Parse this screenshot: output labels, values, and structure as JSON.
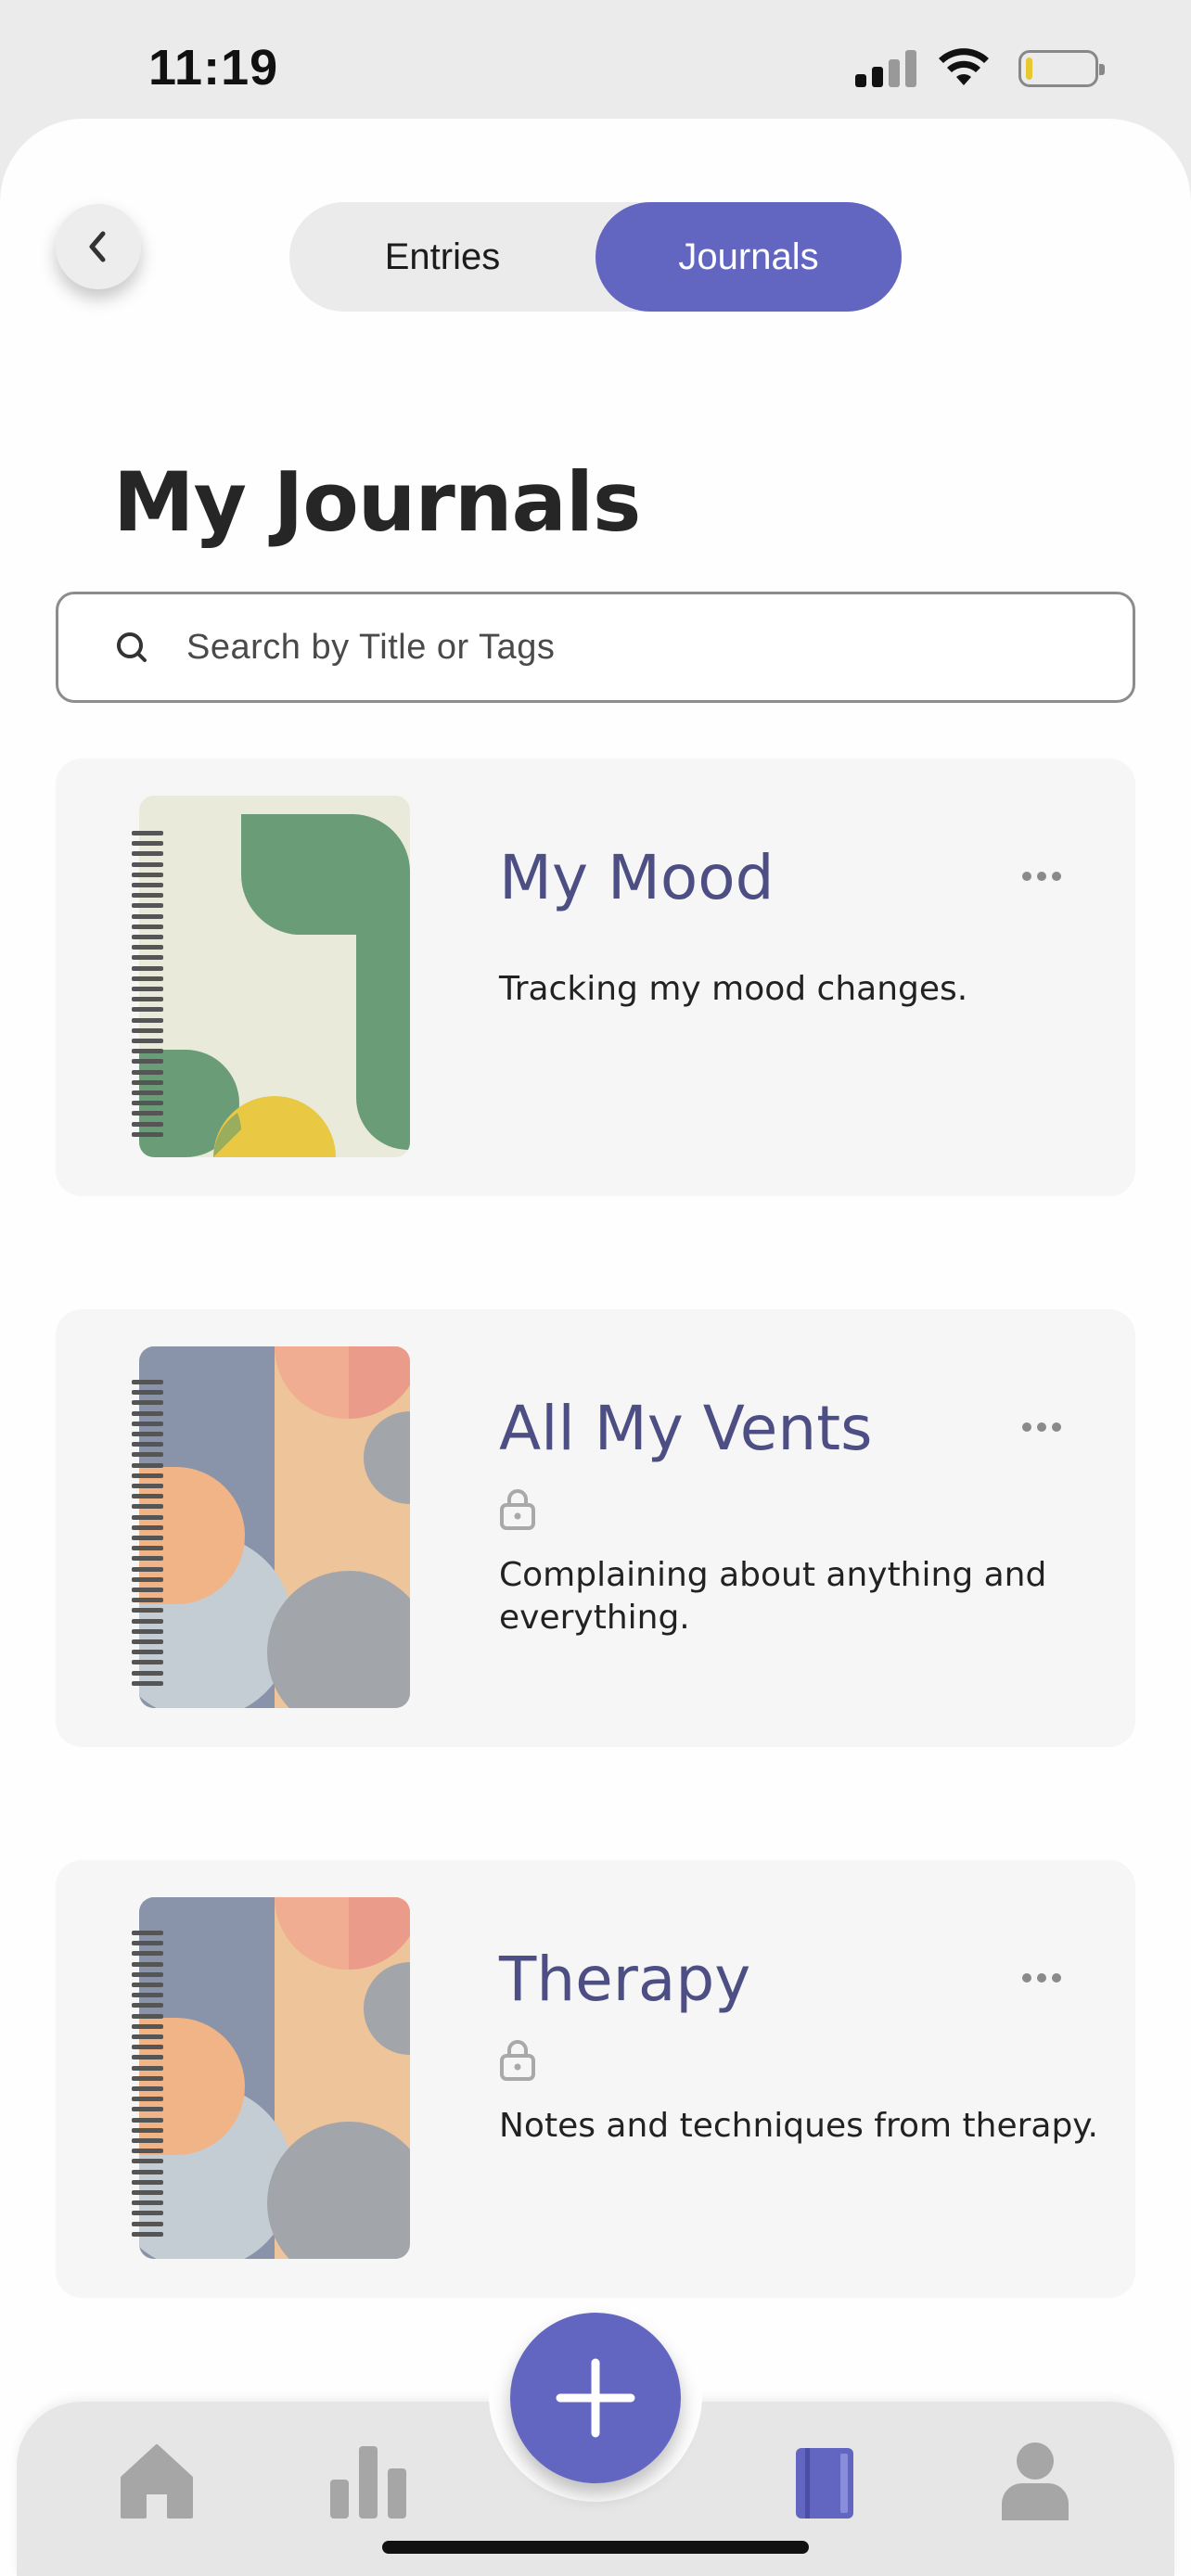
{
  "status_bar": {
    "time": "11:19",
    "battery_level": 0.1
  },
  "header": {
    "segments": [
      {
        "label": "Entries",
        "active": false
      },
      {
        "label": "Journals",
        "active": true
      }
    ]
  },
  "main": {
    "title": "My Journals",
    "search": {
      "placeholder": "Search by Title or Tags"
    },
    "journals": [
      {
        "title": "My Mood",
        "locked": false,
        "description": "Tracking my mood changes.",
        "cover": "green-abstract-cover"
      },
      {
        "title": "All My Vents",
        "locked": true,
        "description": "Complaining about anything and everything.",
        "cover": "pastel-abstract-cover"
      },
      {
        "title": "Therapy",
        "locked": true,
        "description": "Notes and techniques from therapy.",
        "cover": "pastel-abstract-cover"
      }
    ]
  },
  "tab_bar": {
    "items": [
      "home-icon",
      "stats-icon",
      "add-icon",
      "journal-icon",
      "profile-icon"
    ],
    "active": "journal-icon"
  },
  "colors": {
    "accent": "#6366c1",
    "title_text": "#4d4f84",
    "card_bg": "#f6f6f6",
    "cover_green": "#6b9c78",
    "cover_yellow": "#e9c843",
    "cover_blue_gray": "#8994ab",
    "cover_peach": "#efc49a",
    "cover_salmon": "#eb9b8a",
    "cover_gray": "#a2a5aa"
  }
}
